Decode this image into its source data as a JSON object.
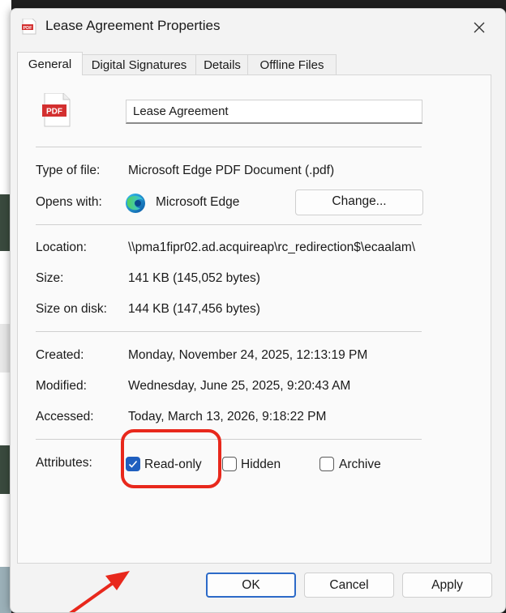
{
  "window": {
    "title": "Lease Agreement Properties",
    "title_icon_text": "PDF"
  },
  "tabs": [
    {
      "label": "General",
      "active": true
    },
    {
      "label": "Digital Signatures",
      "active": false
    },
    {
      "label": "Details",
      "active": false
    },
    {
      "label": "Offline Files",
      "active": false
    }
  ],
  "general": {
    "file_icon_text": "PDF",
    "file_name": "Lease Agreement",
    "type_of_file_label": "Type of file:",
    "type_of_file": "Microsoft Edge PDF Document (.pdf)",
    "opens_with_label": "Opens with:",
    "opens_with": "Microsoft Edge",
    "change_button": "Change...",
    "location_label": "Location:",
    "location": "\\\\pma1fipr02.ad.acquireap\\rc_redirection$\\ecaalam\\",
    "size_label": "Size:",
    "size": "141 KB (145,052 bytes)",
    "size_on_disk_label": "Size on disk:",
    "size_on_disk": "144 KB (147,456 bytes)",
    "created_label": "Created:",
    "created": "Monday, November 24, 2025, 12:13:19 PM",
    "modified_label": "Modified:",
    "modified": "Wednesday, June 25, 2025, 9:20:43 AM",
    "accessed_label": "Accessed:",
    "accessed": "Today, March 13, 2026, 9:18:22 PM",
    "attributes_label": "Attributes:",
    "attributes": [
      {
        "label": "Read-only",
        "checked": true
      },
      {
        "label": "Hidden",
        "checked": false
      },
      {
        "label": "Archive",
        "checked": false
      }
    ]
  },
  "buttons": {
    "ok": "OK",
    "cancel": "Cancel",
    "apply": "Apply"
  },
  "colors": {
    "accent": "#1f5fbf",
    "annotation": "#e8281c",
    "pdf_red": "#d32f2f"
  }
}
